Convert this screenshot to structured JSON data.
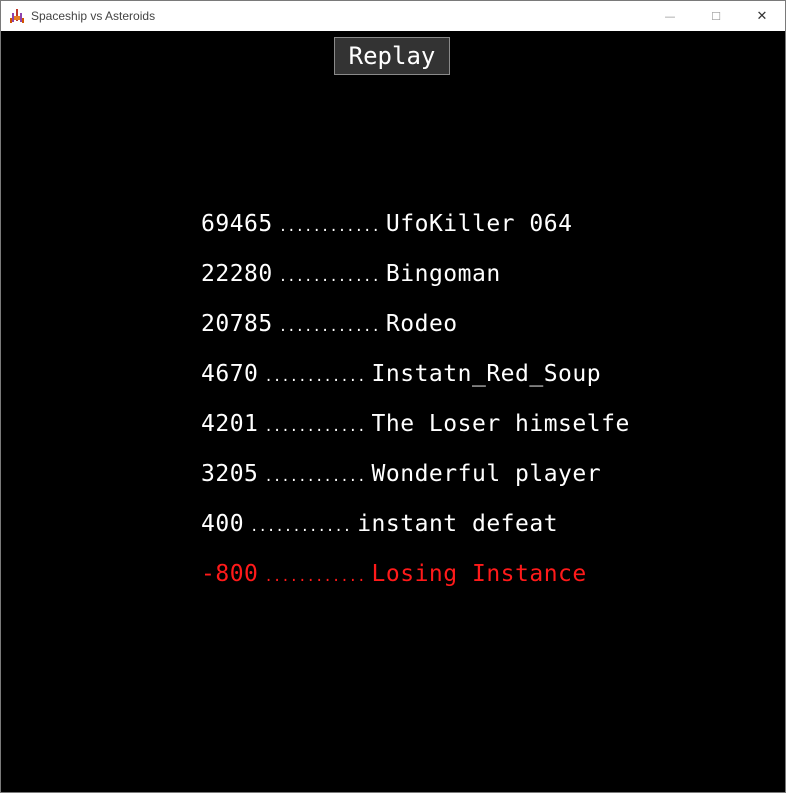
{
  "window": {
    "title": "Spaceship vs Asteroids",
    "controls": {
      "minimize": "—",
      "maximize": "☐",
      "close": "✕"
    }
  },
  "game": {
    "replay_label": "Replay",
    "highscores": [
      {
        "score": "69465",
        "dots": "............",
        "name": "UfoKiller 064"
      },
      {
        "score": "22280",
        "dots": "............",
        "name": "Bingoman"
      },
      {
        "score": "20785",
        "dots": "............",
        "name": "Rodeo"
      },
      {
        "score": "4670",
        "dots": "............",
        "name": "Instatn_Red_Soup"
      },
      {
        "score": "4201",
        "dots": "............",
        "name": "The Loser himselfe"
      },
      {
        "score": "3205",
        "dots": "............",
        "name": "Wonderful player"
      },
      {
        "score": "400",
        "dots": "............",
        "name": "instant defeat"
      },
      {
        "score": "-800",
        "dots": "............",
        "name": "Losing Instance"
      }
    ],
    "colors": {
      "background": "#000000",
      "text": "#ffffff",
      "highlight": "#ff1a1a"
    }
  }
}
